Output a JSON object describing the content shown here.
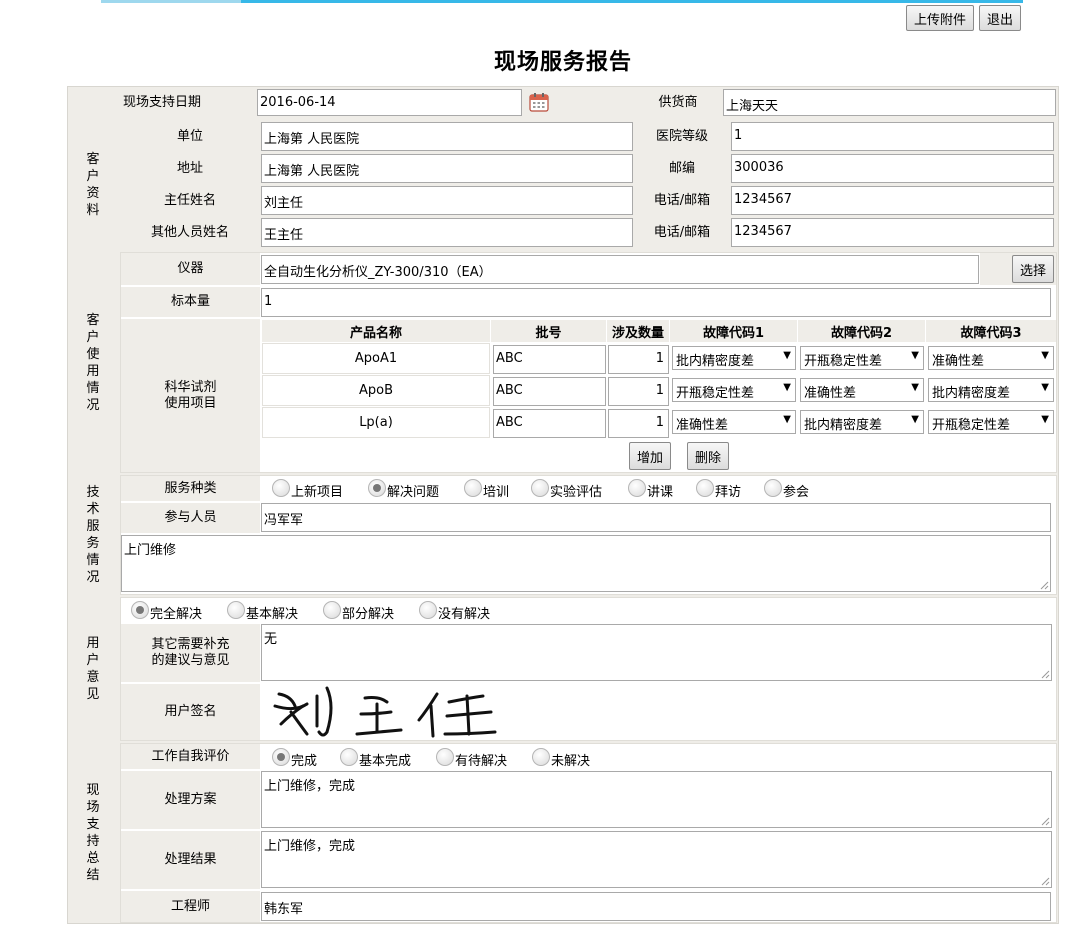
{
  "toolbar": {
    "upload": "上传附件",
    "exit": "退出"
  },
  "title": "现场服务报告",
  "header": {
    "date_label": "现场支持日期",
    "date_value": "2016-06-14",
    "supplier_label": "供货商",
    "supplier_value": "上海天天"
  },
  "customer": {
    "section": "客户资料",
    "unit_label": "单位",
    "unit_value": "上海第    人民医院",
    "level_label": "医院等级",
    "level_value": "1",
    "address_label": "地址",
    "address_value": "上海第    人民医院",
    "zip_label": "邮编",
    "zip_value": "300036",
    "director_label": "主任姓名",
    "director_value": "刘主任",
    "phone1_label": "电话/邮箱",
    "phone1_value": "1234567",
    "others_label": "其他人员姓名",
    "others_value": "王主任",
    "phone2_label": "电话/邮箱",
    "phone2_value": "1234567"
  },
  "usage": {
    "section": "客户使用情况",
    "instrument_label": "仪器",
    "instrument_value": "全自动生化分析仪_ZY-300/310（EA）",
    "select_button": "选择",
    "sample_label": "标本量",
    "sample_value": "1",
    "reagent_label_1": "科华试剂",
    "reagent_label_2": "使用项目",
    "columns": [
      "产品名称",
      "批号",
      "涉及数量",
      "故障代码1",
      "故障代码2",
      "故障代码3"
    ],
    "rows": [
      {
        "name": "ApoA1",
        "batch": "ABC",
        "qty": "1",
        "code1": "批内精密度差",
        "code2": "开瓶稳定性差",
        "code3": "准确性差"
      },
      {
        "name": "ApoB",
        "batch": "ABC",
        "qty": "1",
        "code1": "开瓶稳定性差",
        "code2": "准确性差",
        "code3": "批内精密度差"
      },
      {
        "name": "Lp(a)",
        "batch": "ABC",
        "qty": "1",
        "code1": "准确性差",
        "code2": "批内精密度差",
        "code3": "开瓶稳定性差"
      }
    ],
    "add_button": "增加",
    "delete_button": "删除"
  },
  "service": {
    "section": "技术服务情况",
    "type_label": "服务种类",
    "types": [
      "上新项目",
      "解决问题",
      "培训",
      "实验评估",
      "讲课",
      "拜访",
      "参会"
    ],
    "type_selected": "解决问题",
    "staff_label": "参与人员",
    "staff_value": "冯军军",
    "note": "上门维修"
  },
  "feedback": {
    "section": "用户意见",
    "options": [
      "完全解决",
      "基本解决",
      "部分解决",
      "没有解决"
    ],
    "selected": "完全解决",
    "suggest_label_1": "其它需要补充",
    "suggest_label_2": "的建议与意见",
    "suggest_value": "无",
    "sign_label": "用户签名",
    "signature": "刘主任"
  },
  "summary": {
    "section": "现场支持总结",
    "eval_label": "工作自我评价",
    "evals": [
      "完成",
      "基本完成",
      "有待解决",
      "未解决"
    ],
    "eval_selected": "完成",
    "plan_label": "处理方案",
    "plan_value": "上门维修，完成",
    "result_label": "处理结果",
    "result_value": "上门维修，完成",
    "engineer_label": "工程师",
    "engineer_value": "韩东军"
  },
  "icons": {
    "calendar": "calendar-icon",
    "dropdown": "chevron-down-icon",
    "resize": "resize-grip-icon"
  }
}
